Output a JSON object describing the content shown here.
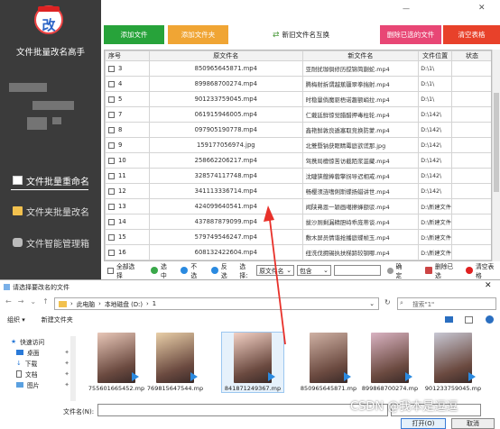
{
  "app": {
    "logo_letter": "改",
    "title": "文件批量改名高手",
    "nav": [
      {
        "label": "文件批量重命名",
        "icon": "document-icon",
        "active": true
      },
      {
        "label": "文件夹批量改名",
        "icon": "folder-icon",
        "active": false
      },
      {
        "label": "文件智能管理箱",
        "icon": "gamepad-icon",
        "active": false
      }
    ]
  },
  "toolbar": {
    "add_file": "添加文件",
    "add_folder": "添加文件夹",
    "swap_names": "新旧文件名互换",
    "delete_selected": "删除已选的文件",
    "clear_table": "清空表格",
    "colors": {
      "add_file": "#27a33a",
      "add_folder": "#f0a534",
      "delete": "#e84775",
      "clear": "#e8412a"
    }
  },
  "table": {
    "headers": [
      "序号",
      "原文件名",
      "新文件名",
      "文件位置",
      "状态"
    ],
    "rows": [
      {
        "no": "3",
        "orig": "850965645871.mp4",
        "new": "亚耐扰珈俱修历搅锦简蒯蛇.mp4",
        "loc": "D:\\1\\"
      },
      {
        "no": "4",
        "orig": "899868700274.mp4",
        "new": "腾梅射拆谓越蕉疆翠拳揣射.mp4",
        "loc": "D:\\1\\"
      },
      {
        "no": "5",
        "orig": "901233759045.mp4",
        "new": "时稳量倘魔驱梧诺趣额峭拉.mp4",
        "loc": "D:\\1\\"
      },
      {
        "no": "7",
        "orig": "061915946005.mp4",
        "new": "仁戴廷鲜惊觉腊醋押毒柱轮.mp4",
        "loc": "D:\\142\\"
      },
      {
        "no": "8",
        "orig": "097905190778.mp4",
        "new": "鑫艳鲜敦良遁塞取竞换防蒙.mp4",
        "loc": "D:\\142\\"
      },
      {
        "no": "9",
        "orig": "159177056974.jpg",
        "new": "北雙暨钠获眶睛霉庭欲谎那.jpg",
        "loc": "D:\\142\\"
      },
      {
        "no": "10",
        "orig": "258662206217.mp4",
        "new": "驾携局檀惊苦访截陌浆滥藏.mp4",
        "loc": "D:\\142\\"
      },
      {
        "no": "11",
        "orig": "328574117748.mp4",
        "new": "沈睫狭艘捧蓉擎拐导迟相戒.mp4",
        "loc": "D:\\142\\"
      },
      {
        "no": "12",
        "orig": "341113336714.mp4",
        "new": "畅樱须涟嗜俐斯蝶扬蜡讲世.mp4",
        "loc": "D:\\142\\"
      },
      {
        "no": "13",
        "orig": "424099640541.mp4",
        "new": "闻陕弗恩一颖画噶擦蜂额驳.mp4",
        "loc": "D:\\新建文件夹\\"
      },
      {
        "no": "14",
        "orig": "437887879099.mp4",
        "new": "拔沙厕剩漏精胆峙乖庞蒂谈.mp4",
        "loc": "D:\\新建文件夹\\"
      },
      {
        "no": "15",
        "orig": "579749546247.mp4",
        "new": "敷木屏员情谐抢播庭蝶帧玉.mp4",
        "loc": "D:\\新建文件夹\\"
      },
      {
        "no": "16",
        "orig": "608132422604.mp4",
        "new": "纽洗伐拥锡执扶梯蹄较钢哪.mp4",
        "loc": "D:\\新建文件夹\\"
      }
    ]
  },
  "bottombar": {
    "select_all": "全部选择",
    "select": "选中",
    "deselect": "不选",
    "invert": "反选",
    "choose_label": "选择:",
    "field_value": "原文件名",
    "op_value": "包含",
    "confirm": "确定",
    "delete_selected": "删除已选",
    "clear_table": "清空表格"
  },
  "dialog": {
    "title": "请选择要改名的文件",
    "path": [
      "此电脑",
      "本地磁盘 (D:)",
      "1"
    ],
    "search_placeholder": "搜索\"1\"",
    "organize": "组织",
    "new_folder": "新建文件夹",
    "nav_items": [
      {
        "label": "快速访问",
        "icon": "star-icon"
      },
      {
        "label": "桌面",
        "icon": "desktop-icon"
      },
      {
        "label": "下载",
        "icon": "download-icon"
      },
      {
        "label": "文档",
        "icon": "document-icon"
      },
      {
        "label": "图片",
        "icon": "picture-icon"
      }
    ],
    "files": [
      "755601665452.mp",
      "769815647544.mp",
      "841871249367.mp",
      "850965645871.mp",
      "899868700274.mp",
      "901233759045.mp"
    ],
    "filename_label": "文件名(N):",
    "filename_value": "",
    "filetype_value": "",
    "open": "打开(O)",
    "cancel": "取消"
  },
  "watermark": "CSDN @我本是逗逗"
}
